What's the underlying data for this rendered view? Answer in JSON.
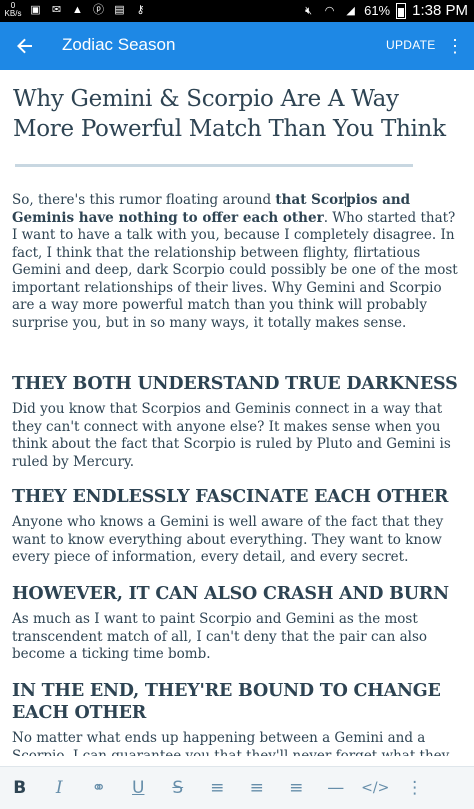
{
  "status_bar": {
    "kb_top": "0",
    "kb_bottom": "KB/s",
    "battery": "61%",
    "time": "1:38 PM",
    "icons": [
      "data-speed",
      "image-icon",
      "gmail-icon",
      "alert-icon",
      "pinterest-icon",
      "sd-card-icon",
      "key-icon",
      "mute-icon",
      "wifi-icon",
      "signal-icon"
    ]
  },
  "app_bar": {
    "title": "Zodiac Season",
    "update_label": "UPDATE",
    "background": "#1e88e5"
  },
  "article": {
    "title": "Why Gemini & Scorpio Are A Way More Powerful Match Than You Think",
    "intro_pre": "So, there's this rumor floating around ",
    "intro_bold_a": "that Scor",
    "intro_bold_b": "pios and Geminis have nothing to offer each other",
    "intro_post": ". Who started that? I want to have a talk with you, because I completely disagree. In fact, I think that the relationship between flighty, flirtatious Gemini and deep, dark Scorpio could possibly be one of the most important relationships of their lives. Why Gemini and Scorpio are a way more powerful match than you think will probably surprise you, but in so many ways, it totally makes sense.",
    "sections": [
      {
        "heading": "THEY BOTH UNDERSTAND TRUE DARKNESS",
        "body": "Did you know that Scorpios and Geminis connect in a way that they can't connect with anyone else? It makes sense when you think about the fact that Scorpio is ruled by Pluto and Gemini is ruled by Mercury."
      },
      {
        "heading": "THEY ENDLESSLY FASCINATE EACH OTHER",
        "body": "Anyone who knows a Gemini is well aware of the fact that they want to know everything about everything. They want to know every piece of information, every detail, and every secret."
      },
      {
        "heading": "HOWEVER, IT CAN ALSO CRASH AND BURN",
        "body": "As much as I want to paint Scorpio and Gemini as the most transcendent match of all, I can't deny that the pair can also become a ticking time bomb."
      },
      {
        "heading": "IN THE END, THEY'RE BOUND TO CHANGE EACH OTHER",
        "body": "No matter what ends up happening between a Gemini and a Scorpio, I can guarantee you that they'll never forget what they gained between them. Because of their differences (and"
      }
    ]
  },
  "toolbar": {
    "bold": "B",
    "italic": "I",
    "link": "⚭",
    "underline": "U",
    "strikethrough": "S",
    "align_left": "≡",
    "align_center": "≡",
    "align_right": "≡",
    "horizontal_rule": "—",
    "html": "</>",
    "more": "⋮"
  }
}
